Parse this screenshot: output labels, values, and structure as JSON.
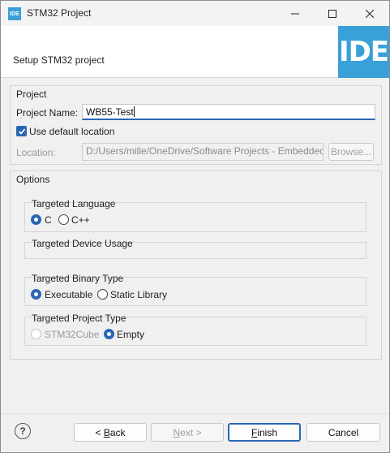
{
  "window": {
    "title": "STM32 Project",
    "app_icon": "IDE",
    "controls": {
      "minimize": "—",
      "maximize": "☐",
      "close": "✕"
    }
  },
  "header": {
    "text": "Setup STM32 project",
    "logo": "IDE"
  },
  "project": {
    "group_title": "Project",
    "name_label": "Project Name:",
    "name_value": "WB55-Test",
    "use_default_label": "Use default location",
    "use_default_checked": true,
    "location_label": "Location:",
    "location_value": "D:/Users/mille/OneDrive/Software Projects - Embeddec",
    "browse_label": "Browse..."
  },
  "options": {
    "group_title": "Options",
    "language": {
      "title": "Targeted Language",
      "options": [
        {
          "label": "C",
          "checked": true
        },
        {
          "label": "C++",
          "checked": false
        }
      ]
    },
    "device_usage": {
      "title": "Targeted Device Usage"
    },
    "binary_type": {
      "title": "Targeted Binary Type",
      "options": [
        {
          "label": "Executable",
          "checked": true
        },
        {
          "label": "Static Library",
          "checked": false
        }
      ]
    },
    "project_type": {
      "title": "Targeted Project Type",
      "options": [
        {
          "label": "STM32Cube",
          "checked": false,
          "disabled": true
        },
        {
          "label": "Empty",
          "checked": true
        }
      ]
    }
  },
  "footer": {
    "help_icon": "question-mark",
    "back_prefix": "< ",
    "back_mnemonic": "B",
    "back_rest": "ack",
    "next_mnemonic": "N",
    "next_rest": "ext >",
    "finish_mnemonic": "F",
    "finish_rest": "inish",
    "cancel_label": "Cancel"
  },
  "colors": {
    "accent": "#2a66b6",
    "logo_bg": "#3aa0d8"
  }
}
